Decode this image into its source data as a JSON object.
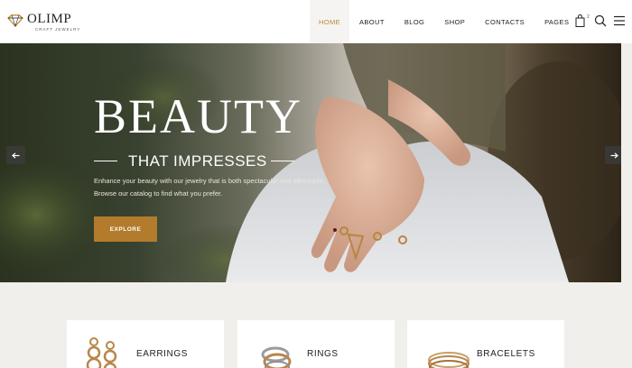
{
  "brand": {
    "title": "OLIMP",
    "tagline": "CRAFT JEWELRY",
    "accent": "#b37b2c"
  },
  "nav": {
    "items": [
      {
        "label": "HOME",
        "active": true
      },
      {
        "label": "ABOUT",
        "active": false
      },
      {
        "label": "BLOG",
        "active": false
      },
      {
        "label": "SHOP",
        "active": false
      },
      {
        "label": "CONTACTS",
        "active": false
      },
      {
        "label": "PAGES",
        "active": false
      }
    ],
    "cart_count": "2",
    "icons": [
      "shopping-bag-icon",
      "search-icon",
      "hamburger-menu-icon"
    ]
  },
  "hero": {
    "title": "BEAUTY",
    "subtitle": "THAT IMPRESSES",
    "description": "Enhance your beauty with our jewelry that is both spectacular and affordable. Browse our catalog to find what you prefer.",
    "button": "EXPLORE",
    "icons": [
      "arrow-left-icon",
      "arrow-right-icon"
    ]
  },
  "categories": [
    {
      "label": "EARRINGS",
      "icon": "earrings-image"
    },
    {
      "label": "RINGS",
      "icon": "rings-image"
    },
    {
      "label": "BRACELETS",
      "icon": "bracelets-image"
    }
  ]
}
